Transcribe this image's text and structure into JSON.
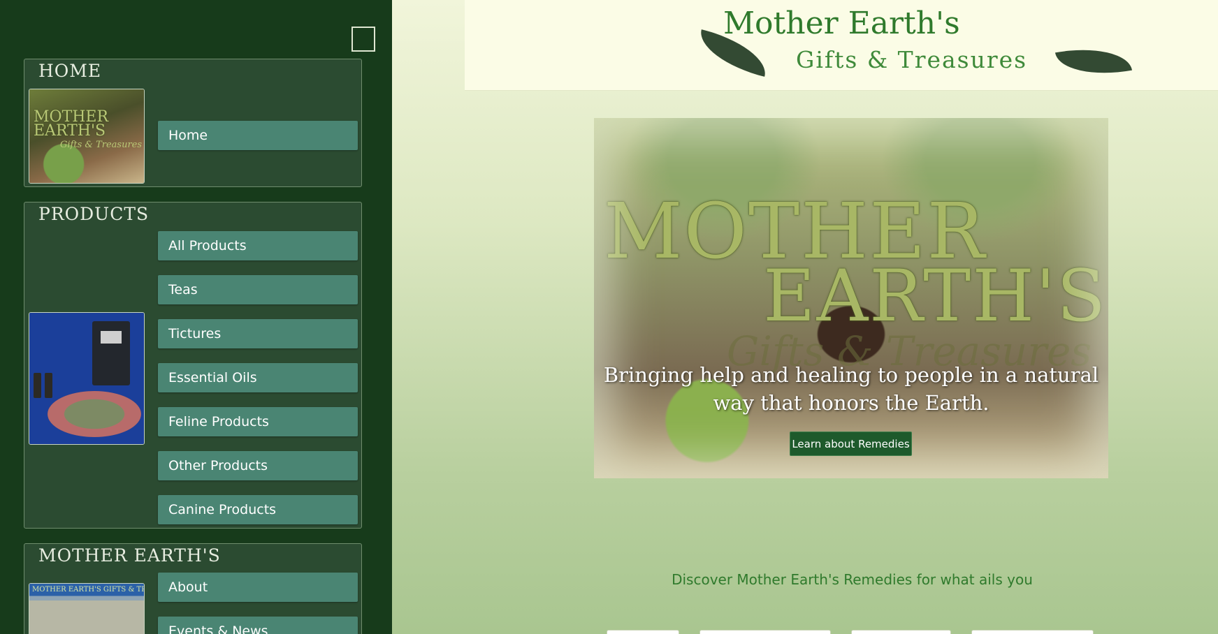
{
  "sidebar": {
    "sections": [
      {
        "title": "HOME",
        "thumbnail": {
          "title_line1": "MOTHER",
          "title_line2": "EARTH'S",
          "subtitle": "Gifts & Treasures"
        },
        "items": [
          {
            "label": "Home"
          }
        ]
      },
      {
        "title": "PRODUCTS",
        "items": [
          {
            "label": "All Products"
          },
          {
            "label": "Teas"
          },
          {
            "label": "Tictures"
          },
          {
            "label": "Essential Oils"
          },
          {
            "label": "Feline Products"
          },
          {
            "label": "Other Products"
          },
          {
            "label": "Canine Products"
          }
        ]
      },
      {
        "title": "MOTHER EARTH'S",
        "thumbnail": {
          "sign": "MOTHER EARTH'S GIFTS & TREASURES"
        },
        "items": [
          {
            "label": "About"
          },
          {
            "label": "Events & News"
          }
        ]
      }
    ]
  },
  "header": {
    "brand_line1": "Mother Earth's",
    "brand_line2": "Gifts & Treasures"
  },
  "hero": {
    "brand_word1": "MOTHER",
    "brand_word2": "EARTH'S",
    "brand_script": "Gifts & Treasures",
    "tagline": "Bringing help and healing to people in a natural way that honors the Earth.",
    "button_label": "Learn about Remedies"
  },
  "discover_text": "Discover Mother Earth's Remedies for what ails you",
  "colors": {
    "sidebar_bg": "#173b1b",
    "section_bg": "#2b4b31",
    "menu_button": "#4a8573",
    "brand_green": "#2f7a2c",
    "hero_button": "#1e5a2c"
  }
}
